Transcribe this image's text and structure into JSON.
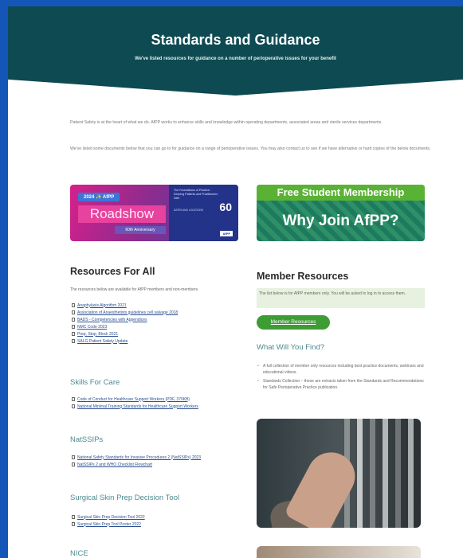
{
  "hero": {
    "title": "Standards and Guidance",
    "subtitle": "We've listed resources for guidance on a number of perioperative issues for your benefit"
  },
  "intro": {
    "p1": "Patient Safety is at the heart of what we do. AfPP works to enhance skills and knowledge within operating departments, associated areas and sterile services departments.",
    "p2": "We've listed some documents below that you can go to for guidance on a range of perioperative issues. You may also contact us to see if we have alternative or hard copies of the below documents."
  },
  "roadshow": {
    "year": "2024 ✨ AfPP",
    "title": "Roadshow",
    "anniversary": "60th Anniversary",
    "panel_title": "The Foundations of Practice: Keeping Patients and Practitioners Safe",
    "sixty": "60",
    "dates": "DATES AND LOCATIONS",
    "brand": "AfPP"
  },
  "join": {
    "top": "Free Student Membership",
    "bottom": "Why Join AfPP?"
  },
  "resources_all": {
    "heading": "Resources For All",
    "note": "The resources below are available for AfPP members and non-members.",
    "items": [
      "Anaphylaxis Algorithm 2021",
      "Association of Anaesthetists guidelines cell salvage 2018",
      "BADS - Competencies with Appendices",
      "NMC Code 2023",
      "Prep, Stop, Block 2021",
      "SALG Patient Safety Update"
    ]
  },
  "skills": {
    "heading": "Skills For Care",
    "items": [
      "Code of Conduct for Healthcare Support Workers (PDF, 370KB)",
      "National Minimal Training Standards for Healthcare Support Workers"
    ]
  },
  "natssips": {
    "heading": "NatSSIPs",
    "items": [
      "National Safety Standards for Invasive Procedures 2 (NatSSIPs) 2023",
      "NatSSIPs 2 and WHO Checklist Flowchart"
    ]
  },
  "skinprep": {
    "heading": "Surgical Skin Prep Decision Tool",
    "items": [
      "Surgical Skin Prep Decision Tool 2022",
      "Surgical Skin Prep Tool Poster 2022"
    ]
  },
  "nice": {
    "heading": "NICE"
  },
  "member": {
    "heading": "Member Resources",
    "note": "The list below is for AfPP members only. You will be asked to log in to access them.",
    "button": "Member Resources",
    "find_heading": "What Will You Find?",
    "bullets": [
      "A full collection of member only resources including best practice documents, webinars and educational videos.",
      "Standards Collection – these are extracts taken from the Standards and Recommendations for Safe Perioperative Practice publication."
    ]
  }
}
